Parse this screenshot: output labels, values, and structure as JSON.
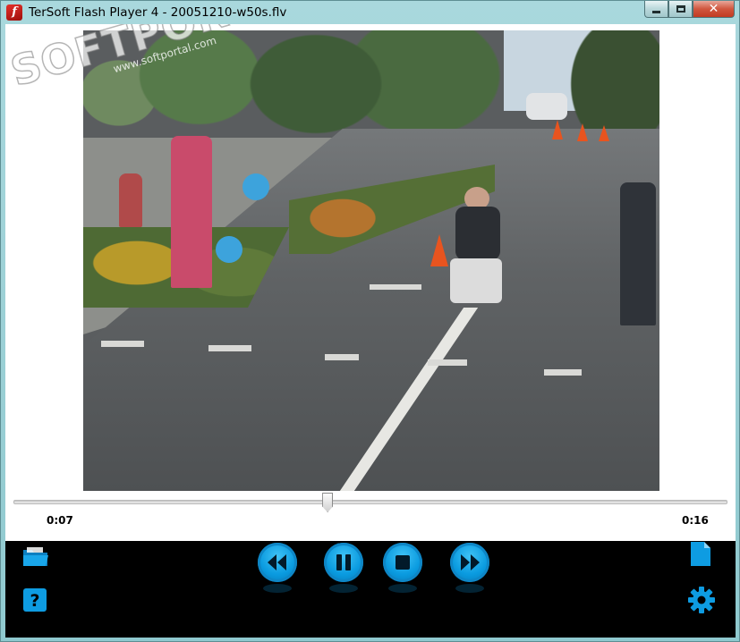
{
  "window": {
    "title": "TerSoft Flash Player 4 - 20051210-w50s.flv",
    "app_icon_letter": "f"
  },
  "watermark": {
    "brand": "SOFTPORTAL",
    "url": "www.softportal.com"
  },
  "playback": {
    "current_time": "0:07",
    "total_time": "0:16",
    "progress_fraction": 0.44
  },
  "controls": {
    "buttons": [
      {
        "name": "rewind",
        "icon": "rewind-icon"
      },
      {
        "name": "pause",
        "icon": "pause-icon"
      },
      {
        "name": "stop",
        "icon": "stop-icon"
      },
      {
        "name": "fast-forward",
        "icon": "fast-forward-icon"
      }
    ],
    "left_icons": [
      "open-folder-icon",
      "help-icon"
    ],
    "right_icons": [
      "file-icon",
      "gear-icon"
    ]
  },
  "colors": {
    "accent": "#0a9be0",
    "control_bar_bg": "#000000",
    "frame": "#a9d8dd"
  }
}
